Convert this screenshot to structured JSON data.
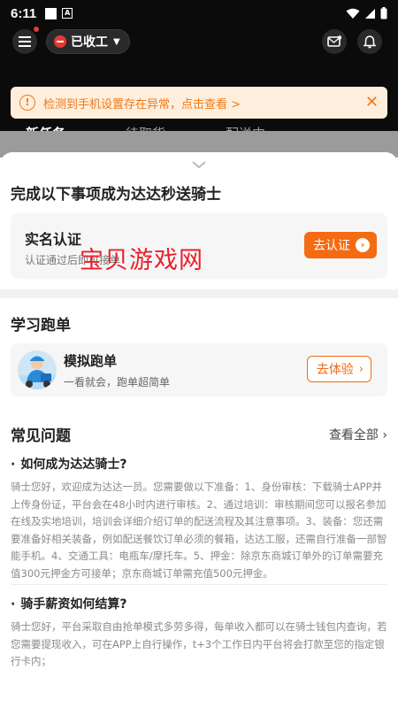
{
  "status_bar": {
    "time": "6:11",
    "a_icon": "A"
  },
  "header": {
    "status_label": "已收工",
    "notice_text": "检测到手机设置存在异常，点击查看 >",
    "tabs": [
      {
        "label": "新任务",
        "active": true
      },
      {
        "label": "待取货",
        "active": false
      },
      {
        "label": "配送中",
        "active": false
      }
    ]
  },
  "sheet": {
    "title": "完成以下事项成为达达秒送骑士",
    "verify_card": {
      "title": "实名认证",
      "subtitle": "认证通过后即可接单",
      "button": "去认证"
    },
    "watermark": "宝贝游戏网",
    "learning": {
      "title": "学习跑单",
      "card_title": "模拟跑单",
      "card_subtitle": "一看就会，跑单超简单",
      "button": "去体验"
    },
    "faq": {
      "title": "常见问题",
      "view_all": "查看全部",
      "items": [
        {
          "question": "如何成为达达骑士?",
          "answer": "骑士您好，欢迎成为达达一员。您需要做以下准备：1、身份审核：下载骑士APP并上传身份证，平台会在48小时内进行审核。2、通过培训：审核期间您可以报名参加在线及实地培训，培训会详细介绍订单的配送流程及其注意事项。3、装备：您还需要准备好相关装备，例如配送餐饮订单必须的餐箱，达达工服，还需自行准备一部智能手机。4、交通工具：电瓶车/摩托车。5、押金：除京东商城订单外的订单需要充值300元押金方可接单；京东商城订单需充值500元押金。"
        },
        {
          "question": "骑手薪资如何结算?",
          "answer": "骑士您好，平台采取自由抢单模式多劳多得，每单收入都可以在骑士钱包内查询，若您需要提现收入，可在APP上自行操作，t+3个工作日内平台将会打款至您的指定银行卡内；"
        }
      ]
    }
  },
  "colors": {
    "accent": "#f46b12",
    "notice_bg": "#fdeede",
    "header_bg": "#0b0b0b",
    "status_red": "#e53935"
  }
}
